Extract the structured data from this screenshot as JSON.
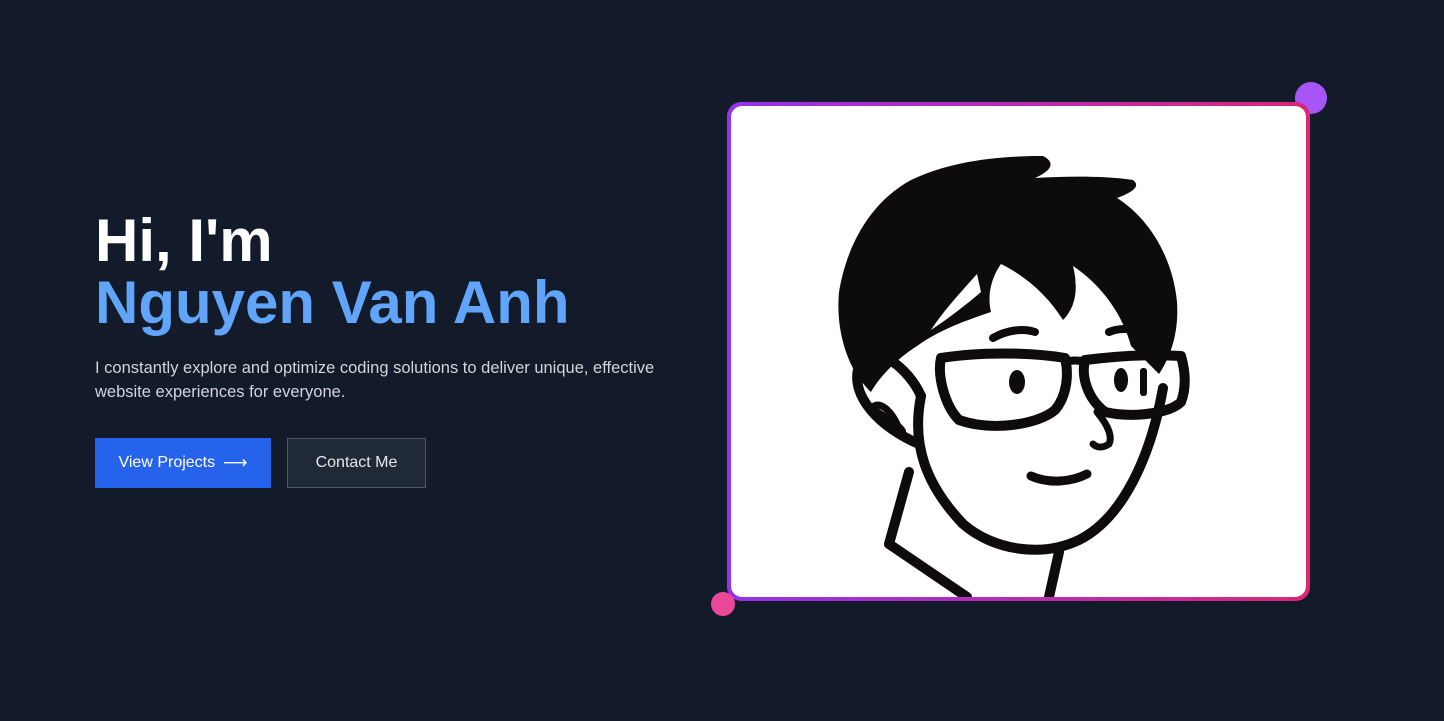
{
  "hero": {
    "greeting_line1": "Hi, I'm",
    "name": "Nguyen Van Anh",
    "tagline": "I constantly explore and optimize coding solutions to deliver unique, effective website experiences for everyone.",
    "buttons": {
      "primary_label": "View Projects",
      "primary_icon": "arrow-right-icon",
      "secondary_label": "Contact Me"
    },
    "portrait": {
      "image": "cartoon-avatar-with-glasses"
    }
  },
  "colors": {
    "background": "#131a2a",
    "name_accent": "#60a5fa",
    "primary_button": "#2563eb",
    "secondary_button": "#1f2937",
    "frame_gradient_start": "#9333ea",
    "frame_gradient_end": "#db2777",
    "dot_top": "#a855f7",
    "dot_bottom": "#ec4899"
  }
}
